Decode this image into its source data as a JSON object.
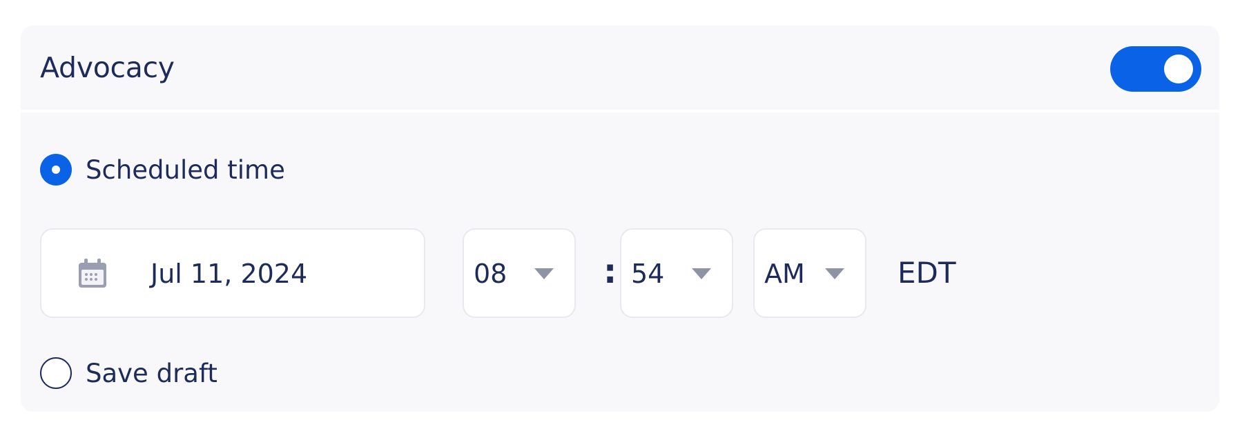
{
  "section": {
    "title": "Advocacy",
    "toggle_enabled": true
  },
  "publish_options": {
    "scheduled": {
      "label": "Scheduled time",
      "selected": true
    },
    "draft": {
      "label": "Save draft",
      "selected": false
    }
  },
  "schedule": {
    "date": "Jul 11, 2024",
    "hour": "08",
    "separator": ":",
    "minute": "54",
    "period": "AM",
    "timezone": "EDT"
  },
  "icons": {
    "calendar": "calendar-icon",
    "dropdown": "chevron-down-icon"
  },
  "colors": {
    "accent": "#0a63e6",
    "text": "#1c2b5a",
    "card_background": "#f8f8fb",
    "caret": "#8f93a6"
  }
}
